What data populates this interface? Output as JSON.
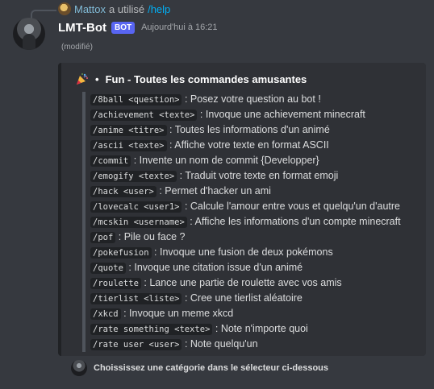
{
  "reply": {
    "user": "Mattox",
    "text": "a utilisé",
    "command": "/help"
  },
  "message": {
    "username": "LMT-Bot",
    "bot_tag": "BOT",
    "timestamp": "Aujourd'hui à 16:21",
    "modified": "(modifié)"
  },
  "embed": {
    "bullet": "•",
    "title": "Fun - Toutes les commandes amusantes",
    "commands": [
      {
        "code": "/8ball <question>",
        "desc": " : Posez votre question au bot !"
      },
      {
        "code": "/achievement <texte>",
        "desc": " : Invoque une achievement minecraft"
      },
      {
        "code": "/anime <titre>",
        "desc": " : Toutes les informations d'un animé"
      },
      {
        "code": "/ascii <texte>",
        "desc": " : Affiche votre texte en format ASCII"
      },
      {
        "code": "/commit",
        "desc": " : Invente un nom de commit {Developper}"
      },
      {
        "code": "/emogify <texte>",
        "desc": " : Traduit votre texte en format emoji"
      },
      {
        "code": "/hack <user>",
        "desc": " : Permet d'hacker un ami"
      },
      {
        "code": "/lovecalc <user1>",
        "desc": " : Calcule l'amour entre vous et quelqu'un d'autre"
      },
      {
        "code": "/mcskin <username>",
        "desc": " : Affiche les informations d'un compte minecraft"
      },
      {
        "code": "/pof",
        "desc": " : Pile ou face ?"
      },
      {
        "code": "/pokefusion",
        "desc": " : Invoque une fusion de deux pokémons"
      },
      {
        "code": "/quote",
        "desc": " : Invoque une citation issue d'un animé"
      },
      {
        "code": "/roulette",
        "desc": " : Lance une partie de roulette avec vos amis"
      },
      {
        "code": "/tierlist <liste>",
        "desc": " : Cree une tierlist aléatoire"
      },
      {
        "code": "/xkcd",
        "desc": " : Invoque un meme xkcd"
      },
      {
        "code": "/rate something <texte>",
        "desc": " : Note n'importe quoi"
      },
      {
        "code": "/rate user <user>",
        "desc": " : Note quelqu'un"
      }
    ]
  },
  "footer": {
    "text": "Choississez une catégorie dans le sélecteur ci-dessous"
  },
  "colors": {
    "background": "#36393f",
    "embed_bg": "#2f3136",
    "bot_tag": "#5865f2",
    "reply_user": "#82bcd8",
    "command_link": "#00aff4"
  }
}
